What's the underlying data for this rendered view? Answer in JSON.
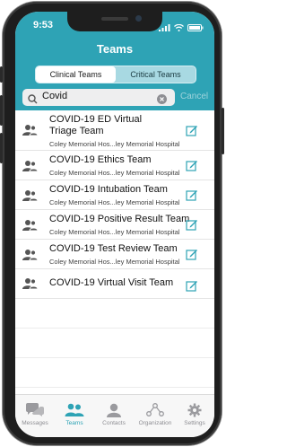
{
  "status": {
    "time": "9:53"
  },
  "header": {
    "title": "Teams"
  },
  "segments": {
    "clinical": "Clinical Teams",
    "critical": "Critical Teams"
  },
  "search": {
    "value": "Covid",
    "cancel": "Cancel"
  },
  "teams": [
    {
      "title_line1": "COVID-19 ED Virtual",
      "title_line2": "Triage Team",
      "subtitle": "Coley Memorial Hos...ley Memorial Hospital"
    },
    {
      "title_line1": "COVID-19 Ethics Team",
      "subtitle": "Coley Memorial Hos...ley Memorial Hospital"
    },
    {
      "title_line1": "COVID-19 Intubation Team",
      "subtitle": "Coley Memorial Hos...ley Memorial Hospital"
    },
    {
      "title_line1": "COVID-19 Positive Result Team",
      "subtitle": "Coley Memorial Hos...ley Memorial Hospital"
    },
    {
      "title_line1": "COVID-19 Test Review Team",
      "subtitle": "Coley Memorial Hos...ley Memorial Hospital"
    },
    {
      "title_line1": "COVID-19 Virtual Visit Team",
      "subtitle": ""
    }
  ],
  "tabbar": {
    "messages": "Messages",
    "teams": "Teams",
    "contacts": "Contacts",
    "organization": "Organization",
    "settings": "Settings"
  },
  "colors": {
    "accent": "#2ea3b5",
    "inactive": "#8e8e93"
  }
}
